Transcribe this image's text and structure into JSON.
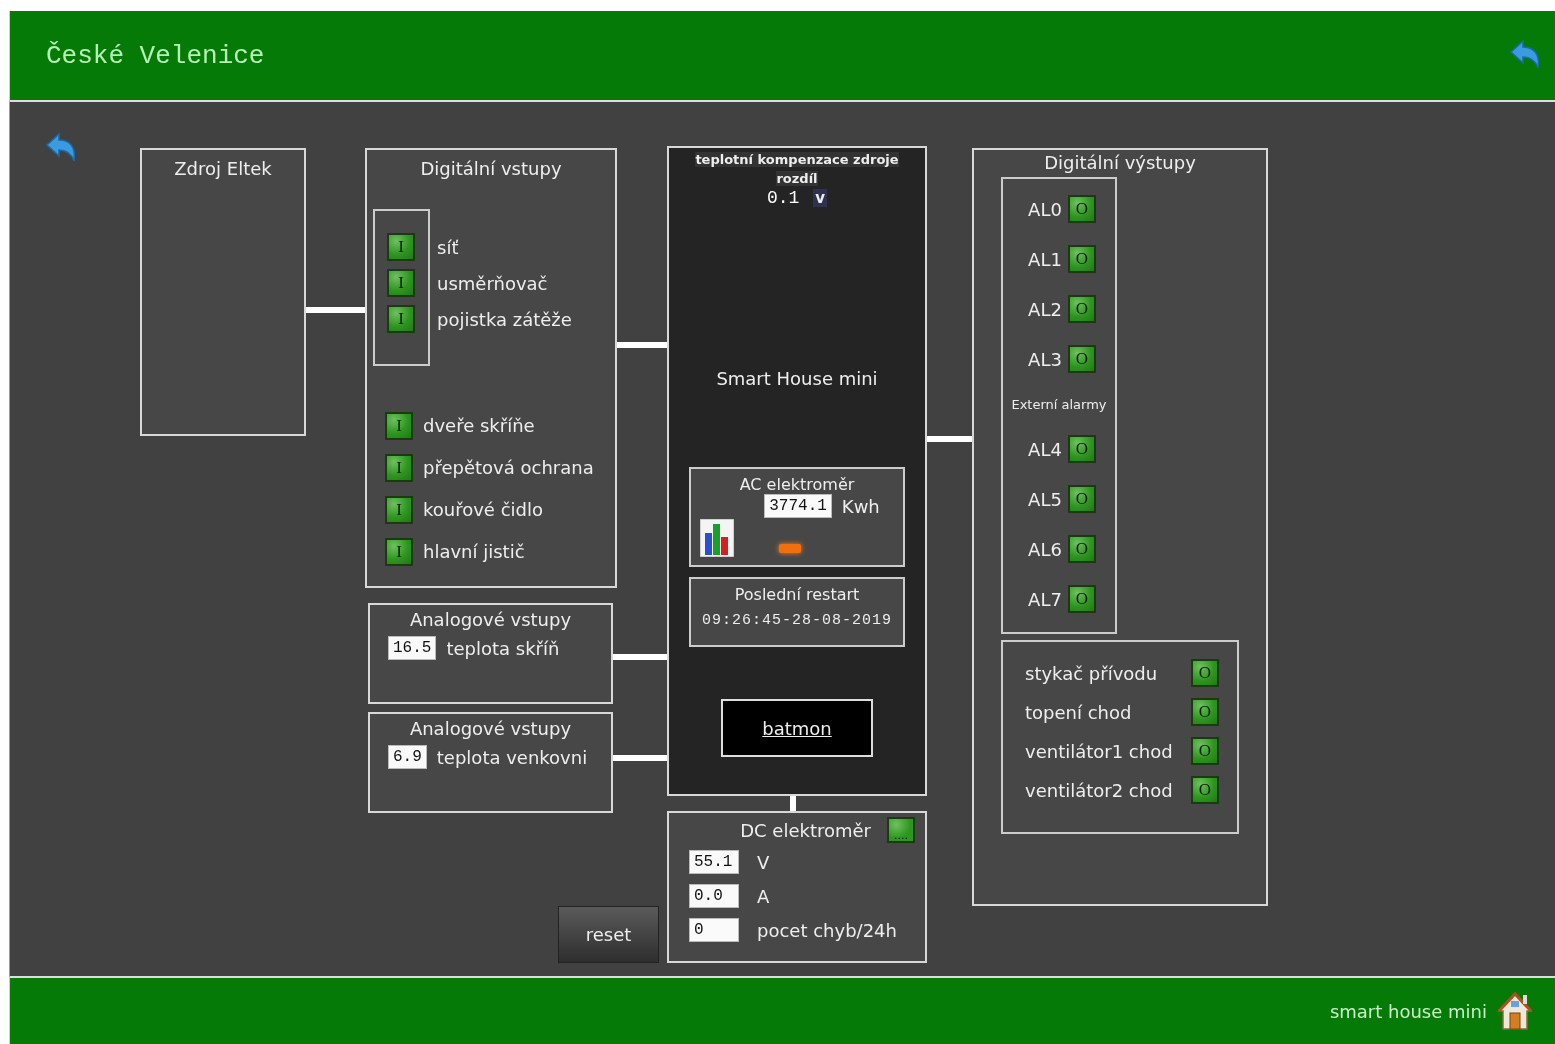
{
  "header": {
    "title": "České Velenice"
  },
  "power_source": {
    "title": "Zdroj Eltek"
  },
  "digital_inputs": {
    "title": "Digitální vstupy",
    "grouped": [
      {
        "indicator": "I",
        "label": "síť",
        "on": true
      },
      {
        "indicator": "I",
        "label": "usměrňovač",
        "on": true
      },
      {
        "indicator": "I",
        "label": "pojistka zátěže",
        "on": true
      }
    ],
    "items": [
      {
        "indicator": "I",
        "label": "dveře skříňe",
        "on": true
      },
      {
        "indicator": "I",
        "label": "přepětová ochrana",
        "on": true
      },
      {
        "indicator": "I",
        "label": "kouřové čidlo",
        "on": true
      },
      {
        "indicator": "I",
        "label": "hlavní jistič",
        "on": true
      }
    ]
  },
  "controller": {
    "compensation_title": "teplotní kompenzace zdroje",
    "difference_label": "rozdíl",
    "difference_value": "0.1",
    "difference_unit": "v",
    "name": "Smart House mini",
    "ac_meter": {
      "title": "AC elektroměr",
      "value": "3774.1",
      "unit": "Kwh"
    },
    "last_restart": {
      "title": "Poslední restart",
      "value": "09:26:45-28-08-2019"
    },
    "link": "batmon"
  },
  "analog_inputs": [
    {
      "title": "Analogové vstupy",
      "value": "16.5",
      "label": "teplota skříň"
    },
    {
      "title": "Analogové vstupy",
      "value": "6.9",
      "label": "teplota venkovni"
    }
  ],
  "dc_meter": {
    "title": "DC elektroměr",
    "indicator": "....",
    "on": true,
    "rows": [
      {
        "value": "55.1",
        "label": "V"
      },
      {
        "value": "0.0",
        "label": "A"
      },
      {
        "value": "0",
        "label": "pocet chyb/24h"
      }
    ]
  },
  "reset_button": "reset",
  "digital_outputs": {
    "title": "Digitální výstupy",
    "alarm_groups": [
      {
        "items": [
          {
            "label": "AL0",
            "indicator": "O",
            "on": true
          },
          {
            "label": "AL1",
            "indicator": "O",
            "on": true
          },
          {
            "label": "AL2",
            "indicator": "O",
            "on": true
          },
          {
            "label": "AL3",
            "indicator": "O",
            "on": true
          }
        ]
      },
      {
        "heading": "Externí alarmy",
        "items": [
          {
            "label": "AL4",
            "indicator": "O",
            "on": true
          },
          {
            "label": "AL5",
            "indicator": "O",
            "on": true
          },
          {
            "label": "AL6",
            "indicator": "O",
            "on": true
          },
          {
            "label": "AL7",
            "indicator": "O",
            "on": true
          }
        ]
      }
    ],
    "relays": [
      {
        "label": "stykač přívodu",
        "indicator": "O",
        "on": true
      },
      {
        "label": "topení chod",
        "indicator": "O",
        "on": true
      },
      {
        "label": "ventilátor1 chod",
        "indicator": "O",
        "on": true
      },
      {
        "label": "ventilátor2 chod",
        "indicator": "O",
        "on": true
      }
    ]
  },
  "footer": {
    "text": "smart house mini"
  }
}
